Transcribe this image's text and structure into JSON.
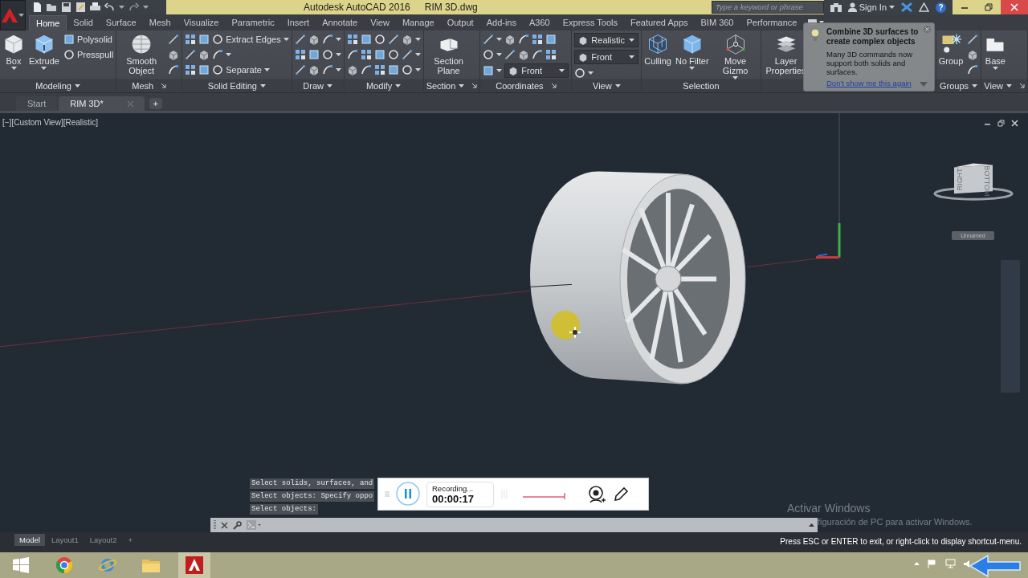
{
  "title_bar": {
    "app_title": "Autodesk AutoCAD 2016",
    "file_name": "RIM 3D.dwg",
    "search_placeholder": "Type a keyword or phrase",
    "sign_in": "Sign In",
    "help": "?"
  },
  "ribbon_tabs": [
    {
      "label": "Home",
      "selected": true
    },
    {
      "label": "Solid",
      "selected": false
    },
    {
      "label": "Surface",
      "selected": false
    },
    {
      "label": "Mesh",
      "selected": false
    },
    {
      "label": "Visualize",
      "selected": false
    },
    {
      "label": "Parametric",
      "selected": false
    },
    {
      "label": "Insert",
      "selected": false
    },
    {
      "label": "Annotate",
      "selected": false
    },
    {
      "label": "View",
      "selected": false
    },
    {
      "label": "Manage",
      "selected": false
    },
    {
      "label": "Output",
      "selected": false
    },
    {
      "label": "Add-ins",
      "selected": false
    },
    {
      "label": "A360",
      "selected": false
    },
    {
      "label": "Express Tools",
      "selected": false
    },
    {
      "label": "Featured Apps",
      "selected": false
    },
    {
      "label": "BIM 360",
      "selected": false
    },
    {
      "label": "Performance",
      "selected": false
    }
  ],
  "ribbon_panels": [
    {
      "title": "Modeling",
      "title_dropdown": true,
      "launcher": false,
      "columns": [
        {
          "kind": "large",
          "label": "Box",
          "dropdown": true
        },
        {
          "kind": "large",
          "label": "Extrude",
          "dropdown": true
        },
        {
          "kind": "rows",
          "rows": [
            [
              {
                "kind": "tool",
                "label": "Polysolid",
                "dropdown": false
              }
            ],
            [
              {
                "kind": "tool",
                "label": "Presspull",
                "dropdown": false
              }
            ]
          ]
        }
      ]
    },
    {
      "title": "Mesh",
      "title_dropdown": false,
      "launcher": true,
      "columns": [
        {
          "kind": "large",
          "label": "Smooth Object",
          "dropdown": false
        },
        {
          "kind": "rows",
          "rows": [
            [
              {
                "kind": "icon",
                "dropdown": false
              }
            ],
            [
              {
                "kind": "icon",
                "dropdown": false
              }
            ],
            [
              {
                "kind": "icon",
                "dropdown": false
              }
            ]
          ]
        }
      ]
    },
    {
      "title": "Solid Editing",
      "title_dropdown": true,
      "launcher": false,
      "columns": [
        {
          "kind": "rows",
          "rows": [
            [
              {
                "kind": "icon",
                "dropdown": false
              },
              {
                "kind": "icon",
                "dropdown": false
              },
              {
                "kind": "tool",
                "label": "Extract Edges",
                "dropdown": true
              }
            ],
            [
              {
                "kind": "icon",
                "dropdown": false
              },
              {
                "kind": "icon",
                "dropdown": false
              },
              {
                "kind": "icon",
                "dropdown": true
              }
            ],
            [
              {
                "kind": "icon",
                "dropdown": false
              },
              {
                "kind": "icon",
                "dropdown": false
              },
              {
                "kind": "tool",
                "label": "Separate",
                "dropdown": true
              }
            ]
          ]
        }
      ]
    },
    {
      "title": "Draw",
      "title_dropdown": true,
      "launcher": false,
      "columns": [
        {
          "kind": "rows",
          "rows": [
            [
              {
                "kind": "icon",
                "dropdown": false
              },
              {
                "kind": "icon",
                "dropdown": false
              },
              {
                "kind": "icon",
                "dropdown": true
              }
            ],
            [
              {
                "kind": "icon",
                "dropdown": false
              },
              {
                "kind": "icon",
                "dropdown": false
              },
              {
                "kind": "icon",
                "dropdown": true
              }
            ],
            [
              {
                "kind": "icon",
                "dropdown": false
              },
              {
                "kind": "icon",
                "dropdown": false
              },
              {
                "kind": "icon",
                "dropdown": true
              }
            ]
          ]
        }
      ]
    },
    {
      "title": "Modify",
      "title_dropdown": true,
      "launcher": false,
      "columns": [
        {
          "kind": "rows",
          "rows": [
            [
              {
                "kind": "icon",
                "dropdown": false
              },
              {
                "kind": "icon",
                "dropdown": false
              },
              {
                "kind": "icon",
                "dropdown": false
              },
              {
                "kind": "icon",
                "dropdown": false
              },
              {
                "kind": "icon",
                "dropdown": true
              }
            ],
            [
              {
                "kind": "icon",
                "dropdown": false
              },
              {
                "kind": "icon",
                "dropdown": false
              },
              {
                "kind": "icon",
                "dropdown": false
              },
              {
                "kind": "icon",
                "dropdown": false
              },
              {
                "kind": "icon",
                "dropdown": true
              }
            ],
            [
              {
                "kind": "icon",
                "dropdown": false
              },
              {
                "kind": "icon",
                "dropdown": false
              },
              {
                "kind": "icon",
                "dropdown": false
              },
              {
                "kind": "icon",
                "dropdown": false
              },
              {
                "kind": "icon",
                "dropdown": true
              }
            ]
          ]
        }
      ]
    },
    {
      "title": "Section",
      "title_dropdown": true,
      "launcher": true,
      "columns": [
        {
          "kind": "large",
          "label": "Section Plane",
          "dropdown": false
        }
      ]
    },
    {
      "title": "Coordinates",
      "title_dropdown": false,
      "launcher": true,
      "columns": [
        {
          "kind": "rows",
          "rows": [
            [
              {
                "kind": "icon",
                "dropdown": true
              },
              {
                "kind": "icon",
                "dropdown": false
              },
              {
                "kind": "icon",
                "dropdown": false
              },
              {
                "kind": "icon",
                "dropdown": false
              },
              {
                "kind": "icon",
                "dropdown": false
              }
            ],
            [
              {
                "kind": "icon",
                "dropdown": true
              },
              {
                "kind": "icon",
                "dropdown": false
              },
              {
                "kind": "icon",
                "dropdown": false
              },
              {
                "kind": "icon",
                "dropdown": false
              },
              {
                "kind": "icon",
                "dropdown": false
              }
            ],
            [
              {
                "kind": "icon",
                "dropdown": true
              },
              {
                "kind": "select",
                "label": "Front"
              }
            ]
          ]
        }
      ]
    },
    {
      "title": "View",
      "title_dropdown": true,
      "launcher": false,
      "columns": [
        {
          "kind": "rows",
          "rows": [
            [
              {
                "kind": "select",
                "label": "Realistic"
              }
            ],
            [
              {
                "kind": "select",
                "label": "Front"
              }
            ],
            [
              {
                "kind": "icon",
                "dropdown": true
              }
            ]
          ]
        }
      ]
    },
    {
      "title": "Selection",
      "title_dropdown": false,
      "launcher": false,
      "columns": [
        {
          "kind": "large",
          "label": "Culling",
          "dropdown": false
        },
        {
          "kind": "large",
          "label": "No Filter",
          "dropdown": true
        },
        {
          "kind": "large",
          "label": "Move Gizmo",
          "dropdown": true
        }
      ]
    },
    {
      "columns": [
        {
          "kind": "large",
          "label": "Layer Properties",
          "dropdown": false
        }
      ]
    },
    {
      "title": "Groups",
      "title_dropdown": true,
      "launcher": false,
      "columns": [
        {
          "kind": "large",
          "label": "Group",
          "dropdown": false
        },
        {
          "kind": "rows",
          "rows": [
            [
              {
                "kind": "icon",
                "dropdown": false
              }
            ],
            [
              {
                "kind": "icon",
                "dropdown": false
              }
            ],
            [
              {
                "kind": "icon",
                "dropdown": false
              }
            ]
          ]
        }
      ]
    },
    {
      "title": "View",
      "title_dropdown": true,
      "launcher": true,
      "columns": [
        {
          "kind": "large",
          "label": "Base",
          "dropdown": true
        }
      ]
    }
  ],
  "tooltip": {
    "title": "Combine 3D surfaces to create complex objects",
    "body": "Many 3D commands now support both solids and surfaces.",
    "link": "Don't show me this again"
  },
  "file_tabs": [
    {
      "label": "Start",
      "selected": false,
      "closable": false
    },
    {
      "label": "RIM 3D*",
      "selected": true,
      "closable": true
    }
  ],
  "new_tab": "+",
  "viewport": {
    "label": "[−][Custom View][Realistic]",
    "viewcube_faces": [
      "RIGHT",
      "BOTTOM"
    ],
    "ucs_menu": "Unnamed"
  },
  "command_history": [
    "Select solids, surfaces, and",
    "Select objects: Specify oppo",
    "Select objects:"
  ],
  "recorder": {
    "status": "Recording...",
    "time": "00:00:17"
  },
  "watermark": {
    "title": "Activar Windows",
    "text": "figuración de PC para activar Windows."
  },
  "layout_tabs": [
    {
      "label": "Model",
      "selected": true
    },
    {
      "label": "Layout1",
      "selected": false
    },
    {
      "label": "Layout2",
      "selected": false
    }
  ],
  "new_layout": "+",
  "status_message": "Press ESC or ENTER to exit, or right-click to display shortcut-menu.",
  "taskbar_apps": [
    {
      "kind": "chrome",
      "active": false
    },
    {
      "kind": "ie",
      "active": false
    },
    {
      "kind": "explorer",
      "active": false
    },
    {
      "kind": "autocad",
      "active": true
    }
  ]
}
